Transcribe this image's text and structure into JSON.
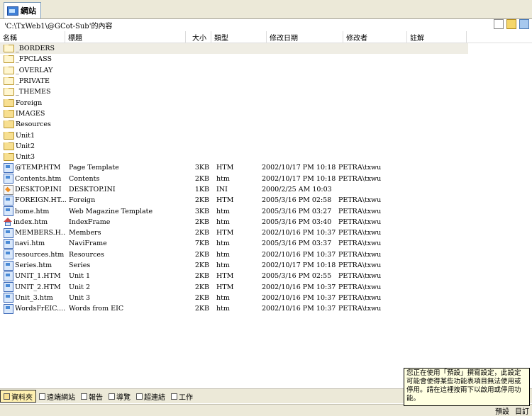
{
  "tab": {
    "label": "網站"
  },
  "path": "'C:\\TxWeb1\\@GCot-Sub'的內容",
  "columns": [
    "名稱",
    "標題",
    "大小",
    "類型",
    "修改日期",
    "修改者",
    "註解"
  ],
  "rows": [
    {
      "icon": "folder-special-icon",
      "name": "_BORDERS",
      "title": "",
      "size": "",
      "type": "",
      "date": "",
      "by": ""
    },
    {
      "icon": "folder-special-icon",
      "name": "_FPCLASS",
      "title": "",
      "size": "",
      "type": "",
      "date": "",
      "by": ""
    },
    {
      "icon": "folder-special-icon",
      "name": "_OVERLAY",
      "title": "",
      "size": "",
      "type": "",
      "date": "",
      "by": ""
    },
    {
      "icon": "folder-special-icon",
      "name": "_PRIVATE",
      "title": "",
      "size": "",
      "type": "",
      "date": "",
      "by": ""
    },
    {
      "icon": "folder-special-icon",
      "name": "_THEMES",
      "title": "",
      "size": "",
      "type": "",
      "date": "",
      "by": ""
    },
    {
      "icon": "folder-icon",
      "name": "Foreign",
      "title": "",
      "size": "",
      "type": "",
      "date": "",
      "by": ""
    },
    {
      "icon": "folder-icon",
      "name": "IMAGES",
      "title": "",
      "size": "",
      "type": "",
      "date": "",
      "by": ""
    },
    {
      "icon": "folder-icon",
      "name": "Resources",
      "title": "",
      "size": "",
      "type": "",
      "date": "",
      "by": ""
    },
    {
      "icon": "folder-icon",
      "name": "Unit1",
      "title": "",
      "size": "",
      "type": "",
      "date": "",
      "by": ""
    },
    {
      "icon": "folder-icon",
      "name": "Unit2",
      "title": "",
      "size": "",
      "type": "",
      "date": "",
      "by": ""
    },
    {
      "icon": "folder-icon",
      "name": "Unit3",
      "title": "",
      "size": "",
      "type": "",
      "date": "",
      "by": ""
    },
    {
      "icon": "web-page-icon",
      "name": "@TEMP.HTM",
      "title": "Page Template",
      "size": "3KB",
      "type": "HTM",
      "date": "2002/10/17 PM 10:18",
      "by": "PETRA\\txwu"
    },
    {
      "icon": "web-page-icon",
      "name": "Contents.htm",
      "title": "Contents",
      "size": "2KB",
      "type": "htm",
      "date": "2002/10/17 PM 10:18",
      "by": "PETRA\\txwu"
    },
    {
      "icon": "ini-file-icon",
      "name": "DESKTOP.INI",
      "title": "DESKTOP.INI",
      "size": "1KB",
      "type": "INI",
      "date": "2000/2/25 AM 10:03",
      "by": ""
    },
    {
      "icon": "web-page-icon",
      "name": "FOREIGN.HT...",
      "title": "Foreign",
      "size": "2KB",
      "type": "HTM",
      "date": "2005/3/16 PM 02:58",
      "by": "PETRA\\txwu"
    },
    {
      "icon": "web-page-icon",
      "name": "home.htm",
      "title": "Web Magazine Template",
      "size": "3KB",
      "type": "htm",
      "date": "2005/3/16 PM 03:27",
      "by": "PETRA\\txwu"
    },
    {
      "icon": "home-page-icon",
      "name": "index.htm",
      "title": "IndexFrame",
      "size": "2KB",
      "type": "htm",
      "date": "2005/3/16 PM 03:40",
      "by": "PETRA\\txwu"
    },
    {
      "icon": "web-page-icon",
      "name": "MEMBERS.H...",
      "title": "Members",
      "size": "2KB",
      "type": "HTM",
      "date": "2002/10/16 PM 10:37",
      "by": "PETRA\\txwu"
    },
    {
      "icon": "web-page-icon",
      "name": "navi.htm",
      "title": "NaviFrame",
      "size": "7KB",
      "type": "htm",
      "date": "2005/3/16 PM 03:37",
      "by": "PETRA\\txwu"
    },
    {
      "icon": "web-page-icon",
      "name": "resources.htm",
      "title": "Resources",
      "size": "2KB",
      "type": "htm",
      "date": "2002/10/16 PM 10:37",
      "by": "PETRA\\txwu"
    },
    {
      "icon": "web-page-icon",
      "name": "Series.htm",
      "title": "Series",
      "size": "2KB",
      "type": "htm",
      "date": "2002/10/17 PM 10:18",
      "by": "PETRA\\txwu"
    },
    {
      "icon": "web-page-icon",
      "name": "UNIT_1.HTM",
      "title": "Unit 1",
      "size": "2KB",
      "type": "HTM",
      "date": "2005/3/16 PM 02:55",
      "by": "PETRA\\txwu"
    },
    {
      "icon": "web-page-icon",
      "name": "UNIT_2.HTM",
      "title": "Unit 2",
      "size": "2KB",
      "type": "HTM",
      "date": "2002/10/16 PM 10:37",
      "by": "PETRA\\txwu"
    },
    {
      "icon": "web-page-icon",
      "name": "Unit_3.htm",
      "title": "Unit 3",
      "size": "2KB",
      "type": "htm",
      "date": "2002/10/16 PM 10:37",
      "by": "PETRA\\txwu"
    },
    {
      "icon": "web-page-icon",
      "name": "WordsFrEIC....",
      "title": "Words from EIC",
      "size": "2KB",
      "type": "htm",
      "date": "2002/10/16 PM 10:37",
      "by": "PETRA\\txwu"
    }
  ],
  "bottom_tabs": [
    {
      "label": "資料夾",
      "icon": "folder-icon",
      "active": true
    },
    {
      "label": "遠端網站",
      "icon": "remote-site-icon",
      "active": false
    },
    {
      "label": "報告",
      "icon": "report-icon",
      "active": false
    },
    {
      "label": "導覽",
      "icon": "navigation-icon",
      "active": false
    },
    {
      "label": "超連結",
      "icon": "hyperlink-icon",
      "active": false
    },
    {
      "label": "工作",
      "icon": "tasks-icon",
      "active": false
    }
  ],
  "tooltip": "您正在使用「預設」撰寫設定，此設定可能會使得某些功能表項目無法使用或停用。請在這裡按兩下以啟用或停用功能。",
  "status": {
    "left_label": "預設",
    "right_label": "目訂"
  }
}
